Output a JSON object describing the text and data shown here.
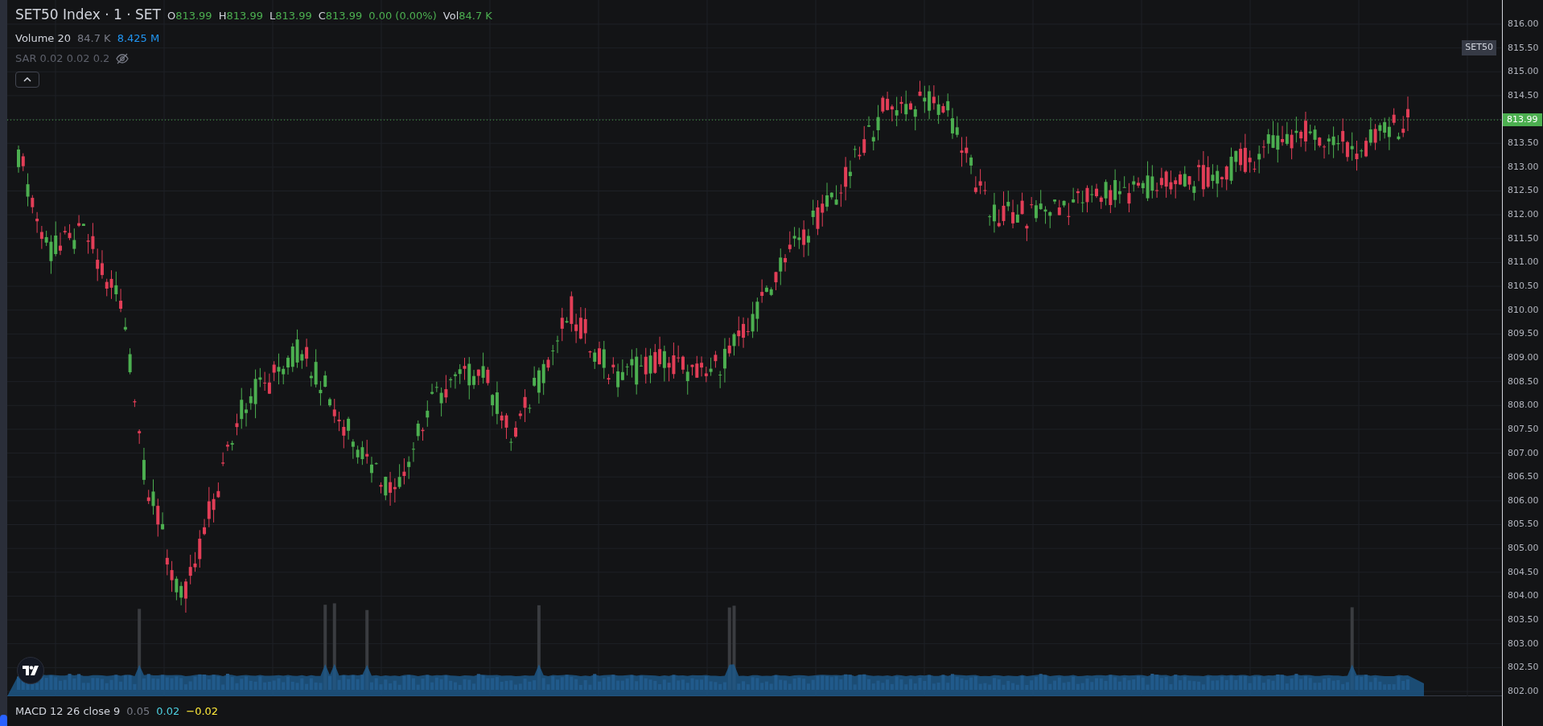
{
  "legend": {
    "symbol": "SET50 Index · 1 · SET",
    "ohlc": [
      {
        "label": "O",
        "value": "813.99"
      },
      {
        "label": "H",
        "value": "813.99"
      },
      {
        "label": "L",
        "value": "813.99"
      },
      {
        "label": "C",
        "value": "813.99"
      }
    ],
    "change": "0.00 (0.00%)",
    "vol_label": "Vol",
    "vol_value": "84.7 K"
  },
  "volume_indicator": {
    "name": "Volume 20",
    "values": [
      {
        "text": "84.7 K",
        "color": "#787b86"
      },
      {
        "text": "8.425 M",
        "color": "#2196f3"
      }
    ]
  },
  "sar_indicator": {
    "name": "SAR 0.02 0.02 0.2",
    "hidden": true
  },
  "symbol_badge": "SET50",
  "price_axis": {
    "labels": [
      {
        "kind": "tick",
        "text": "816.00"
      },
      {
        "kind": "tick",
        "text": "815.50"
      },
      {
        "kind": "tick",
        "text": "815.00"
      },
      {
        "kind": "tick",
        "text": "814.50"
      },
      {
        "kind": "last_price",
        "text": "813.99"
      }
    ],
    "ticks": [
      "813.50",
      "813.00",
      "812.50",
      "812.00",
      "811.50",
      "811.00",
      "810.50",
      "810.00",
      "809.50",
      "809.00",
      "808.50",
      "808.00",
      "807.50",
      "807.00",
      "806.50",
      "806.00",
      "805.50",
      "805.00",
      "804.50",
      "804.00",
      "803.50",
      "803.00",
      "802.50",
      "802.00"
    ]
  },
  "macd_indicator": {
    "name": "MACD 12 26 close 9",
    "values": [
      {
        "text": "0.05",
        "color": "#787b86"
      },
      {
        "text": "0.02",
        "color": "#4dd0e1"
      },
      {
        "text": "−0.02",
        "color": "#ffeb3b"
      }
    ]
  }
}
